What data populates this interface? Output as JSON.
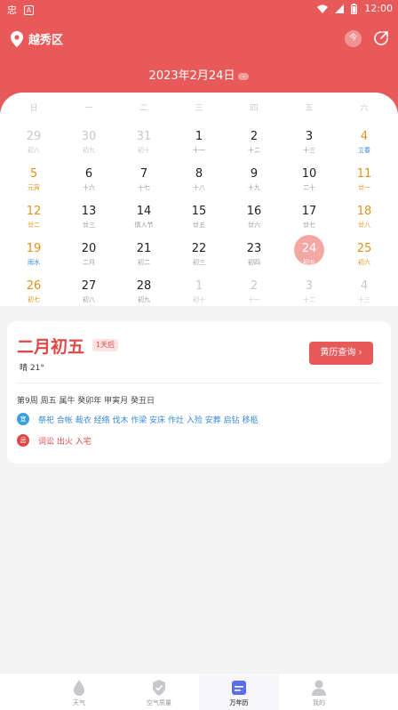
{
  "status_bar": {
    "left_icon_1": "忠",
    "left_icon_2": "A",
    "time": "12:00"
  },
  "header": {
    "location": "越秀区",
    "today_label": "今",
    "date_title": "2023年2月24日",
    "dropdown_glyph": "⌄",
    "bg_color": "#e85a5a"
  },
  "calendar": {
    "weekdays": [
      "日",
      "一",
      "二",
      "三",
      "四",
      "五",
      "六"
    ],
    "rows": [
      [
        {
          "n": "29",
          "l": "初八",
          "t": "other"
        },
        {
          "n": "30",
          "l": "初九",
          "t": "other"
        },
        {
          "n": "31",
          "l": "初十",
          "t": "other"
        },
        {
          "n": "1",
          "l": "十一",
          "t": ""
        },
        {
          "n": "2",
          "l": "十二",
          "t": ""
        },
        {
          "n": "3",
          "l": "十三",
          "t": ""
        },
        {
          "n": "4",
          "l": "立春",
          "t": "weekend blue"
        }
      ],
      [
        {
          "n": "5",
          "l": "元宵",
          "t": "weekend"
        },
        {
          "n": "6",
          "l": "十六",
          "t": ""
        },
        {
          "n": "7",
          "l": "十七",
          "t": ""
        },
        {
          "n": "8",
          "l": "十八",
          "t": ""
        },
        {
          "n": "9",
          "l": "十九",
          "t": ""
        },
        {
          "n": "10",
          "l": "二十",
          "t": ""
        },
        {
          "n": "11",
          "l": "廿一",
          "t": "weekend"
        }
      ],
      [
        {
          "n": "12",
          "l": "廿二",
          "t": "weekend"
        },
        {
          "n": "13",
          "l": "廿三",
          "t": ""
        },
        {
          "n": "14",
          "l": "情人节",
          "t": ""
        },
        {
          "n": "15",
          "l": "廿五",
          "t": ""
        },
        {
          "n": "16",
          "l": "廿六",
          "t": ""
        },
        {
          "n": "17",
          "l": "廿七",
          "t": ""
        },
        {
          "n": "18",
          "l": "廿八",
          "t": "weekend"
        }
      ],
      [
        {
          "n": "19",
          "l": "雨水",
          "t": "weekend blue"
        },
        {
          "n": "20",
          "l": "二月",
          "t": ""
        },
        {
          "n": "21",
          "l": "初二",
          "t": ""
        },
        {
          "n": "22",
          "l": "初三",
          "t": ""
        },
        {
          "n": "23",
          "l": "初四",
          "t": ""
        },
        {
          "n": "24",
          "l": "初五",
          "t": "sel"
        },
        {
          "n": "25",
          "l": "初六",
          "t": "weekend"
        }
      ],
      [
        {
          "n": "26",
          "l": "初七",
          "t": "weekend"
        },
        {
          "n": "27",
          "l": "初八",
          "t": ""
        },
        {
          "n": "28",
          "l": "初九",
          "t": ""
        },
        {
          "n": "1",
          "l": "初十",
          "t": "other"
        },
        {
          "n": "2",
          "l": "十一",
          "t": "other"
        },
        {
          "n": "3",
          "l": "十二",
          "t": "other"
        },
        {
          "n": "4",
          "l": "十三",
          "t": "other"
        }
      ]
    ]
  },
  "detail": {
    "lunar_date": "二月初五",
    "days_badge": "1天后",
    "weather": "晴 21°",
    "almanac_button": "黄历查询",
    "info_line": "第9周 周五 属牛 癸卯年 甲寅月 癸丑日",
    "yi_tag": "宜",
    "yi_text": "祭祀 合帐 裁衣 经络 伐木 作梁 安床 作灶 入殓 安葬 启钻 移柩",
    "ji_tag": "忌",
    "ji_text": "词讼 出火 入宅"
  },
  "bottom_nav": {
    "items": [
      {
        "label": "天气",
        "icon": "weather-icon"
      },
      {
        "label": "空气质量",
        "icon": "shield-check-icon"
      },
      {
        "label": "万年历",
        "icon": "calendar-icon"
      },
      {
        "label": "我的",
        "icon": "person-icon"
      }
    ],
    "active_index": 2
  }
}
